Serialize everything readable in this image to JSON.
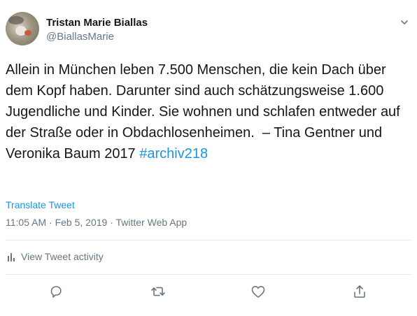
{
  "author": {
    "display_name": "Tristan Marie Biallas",
    "handle": "@BiallasMarie"
  },
  "tweet": {
    "text": "Allein in München leben 7.500 Menschen, die kein Dach über dem Kopf haben. Darunter sind auch schätzungsweise 1.600 Jugendliche und Kinder. Sie wohnen und schlafen entweder auf der Straße oder in Obdachlosenheimen.  – Tina Gentner und Veronika Baum 2017 ",
    "hashtag": "#archiv218"
  },
  "translate_label": "Translate Tweet",
  "meta": {
    "time": "11:05 AM",
    "date": "Feb 5, 2019",
    "source": "Twitter Web App",
    "separator": " · "
  },
  "activity_label": "View Tweet activity",
  "icons": {
    "more": "chevron-down-icon",
    "activity": "bar-chart-icon",
    "reply": "reply-icon",
    "retweet": "retweet-icon",
    "like": "heart-icon",
    "share": "share-icon"
  },
  "colors": {
    "link": "#1b95e0",
    "secondary_text": "#657786",
    "primary_text": "#14171a",
    "divider": "#e6ecf0"
  }
}
